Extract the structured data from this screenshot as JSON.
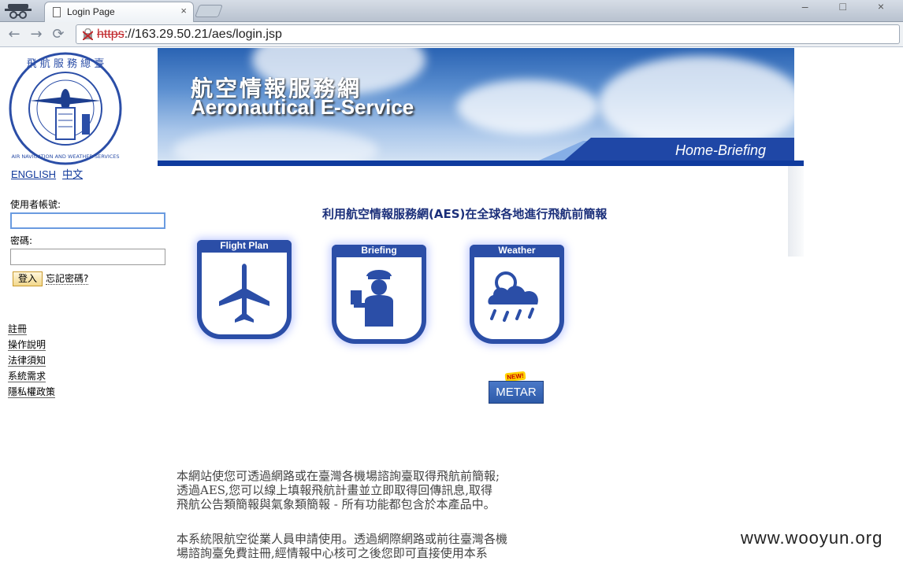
{
  "browser": {
    "tab_title": "Login Page",
    "tab_close": "×",
    "window_controls": "– □ ×",
    "url_scheme": "https",
    "url_rest": "://163.29.50.21/aes/login.jsp",
    "back_glyph": "←",
    "forward_glyph": "→",
    "reload_glyph": "⟳"
  },
  "banner": {
    "title_zh": "航空情報服務網",
    "title_en": "Aeronautical E-Service",
    "home_label": "Home-Briefing"
  },
  "sidebar": {
    "lang_en": "ENGLISH",
    "lang_zh": "中文",
    "username_label": "使用者帳號:",
    "username_value": "",
    "password_label": "密碼:",
    "password_value": "",
    "login_button": "登入",
    "forgot_password": "忘記密碼?",
    "menu": [
      "註冊",
      "操作說明",
      "法律須知",
      "系統需求",
      "隱私權政策"
    ]
  },
  "main": {
    "headline": "利用航空情報服務網(AES)在全球各地進行飛航前簡報",
    "cards": [
      {
        "label": "Flight Plan",
        "icon": "airplane-icon"
      },
      {
        "label": "Briefing",
        "icon": "briefing-officer-icon"
      },
      {
        "label": "Weather",
        "icon": "rain-cloud-icon"
      }
    ],
    "new_badge": "NEW!",
    "metar_label": "METAR",
    "paragraph1_line1": "本網站使您可透過網路或在臺灣各機場諮詢臺取得飛航前簡報;",
    "paragraph1_line2": "透過AES,您可以線上填報飛航計畫並立即取得回傳訊息,取得",
    "paragraph1_line3": "飛航公告類簡報與氣象類簡報 - 所有功能都包含於本產品中。",
    "paragraph2_line1": "本系統限航空從業人員申請使用。透過網際網路或前往臺灣各機",
    "paragraph2_line2": "場諮詢臺免費註冊,經情報中心核可之後您即可直接使用本系"
  },
  "watermark": "www.wooyun.org",
  "colors": {
    "brand_blue": "#2b4ea7",
    "headline_blue": "#1b2f7a",
    "link_blue": "#123a9c",
    "url_strike_red": "#c0262a"
  }
}
